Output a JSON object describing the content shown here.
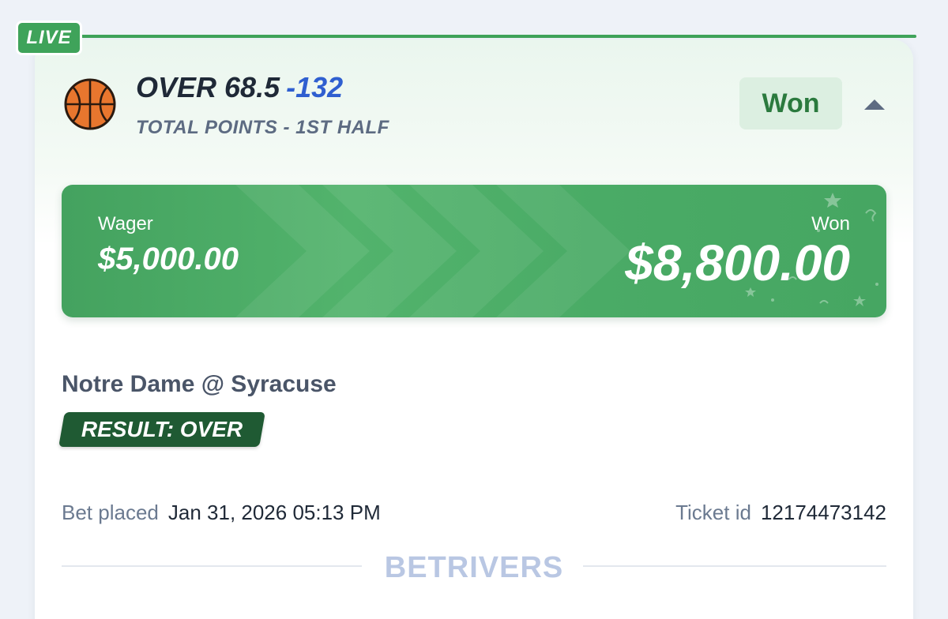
{
  "badge": {
    "label": "LIVE"
  },
  "bet": {
    "selection": "OVER 68.5",
    "odds": "-132",
    "market": "TOTAL POINTS - 1ST HALF",
    "status": "Won"
  },
  "payout": {
    "wager_label": "Wager",
    "wager_amount": "$5,000.00",
    "won_label": "Won",
    "won_amount": "$8,800.00"
  },
  "event": {
    "name": "Notre Dame @ Syracuse",
    "result": "RESULT: OVER"
  },
  "meta": {
    "placed_label": "Bet placed",
    "placed_value": "Jan 31, 2026 05:13 PM",
    "ticket_label": "Ticket id",
    "ticket_value": "12174473142"
  },
  "brand": {
    "name": "BETRIVERS"
  },
  "icons": {
    "sport": "basketball-icon",
    "collapse": "caret-up-icon"
  },
  "colors": {
    "accent_green": "#3fa35a",
    "won_text": "#2b7a3e",
    "odds_blue": "#2f5fd0",
    "result_badge": "#1f5a33"
  }
}
